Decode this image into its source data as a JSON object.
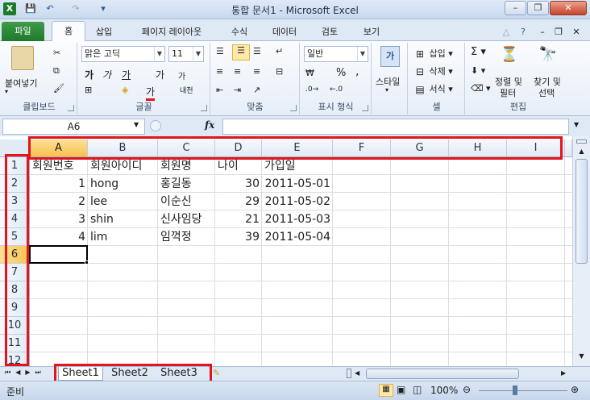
{
  "window": {
    "title": "통합 문서1  -  Microsoft Excel",
    "minimize": "–",
    "restore": "❐",
    "close": "✕"
  },
  "quick_access": {
    "save_icon": "save-icon",
    "undo_icon": "undo-icon",
    "redo_icon": "redo-icon"
  },
  "tabs": [
    {
      "label": "파일"
    },
    {
      "label": "홈"
    },
    {
      "label": "삽입"
    },
    {
      "label": "페이지 레이아웃"
    },
    {
      "label": "수식"
    },
    {
      "label": "데이터"
    },
    {
      "label": "검토"
    },
    {
      "label": "보기"
    }
  ],
  "ribbon": {
    "clipboard": {
      "label": "클립보드",
      "paste": "붙여넣기"
    },
    "font": {
      "label": "글꼴",
      "name": "맑은 고딕",
      "size": "11",
      "bold": "가",
      "italic": "가",
      "underline": "가",
      "grow": "가",
      "shrink": "가",
      "color": "가",
      "phonetic": "내천"
    },
    "alignment": {
      "label": "맞춤"
    },
    "number": {
      "label": "표시 형식",
      "format": "일반",
      "percent": "%",
      "comma": ","
    },
    "styles": {
      "label": "스타일"
    },
    "cells": {
      "label": "셀",
      "insert": "삽입",
      "delete": "삭제",
      "format": "서식"
    },
    "editing": {
      "label": "편집",
      "sort": "정렬 및",
      "sort2": "필터",
      "find": "찾기 및",
      "find2": "선택"
    }
  },
  "formula_bar": {
    "name_box": "A6",
    "fx": "fx",
    "value": ""
  },
  "columns": [
    "A",
    "B",
    "C",
    "D",
    "E",
    "F",
    "G",
    "H",
    "I"
  ],
  "rows": [
    "1",
    "2",
    "3",
    "4",
    "5",
    "6",
    "7",
    "8",
    "9",
    "10",
    "11",
    "12"
  ],
  "cells": {
    "r1": [
      "회원번호",
      "회원아이디",
      "회원명",
      "나이",
      "가입일"
    ],
    "r2": [
      "1",
      "hong",
      "홍길동",
      "30",
      "2011-05-01"
    ],
    "r3": [
      "2",
      "lee",
      "이순신",
      "29",
      "2011-05-02"
    ],
    "r4": [
      "3",
      "shin",
      "신사임당",
      "21",
      "2011-05-03"
    ],
    "r5": [
      "4",
      "lim",
      "임꺽정",
      "39",
      "2011-05-04"
    ]
  },
  "sheets": [
    "Sheet1",
    "Sheet2",
    "Sheet3"
  ],
  "status": {
    "mode": "준비",
    "zoom": "100%"
  },
  "colors": {
    "highlight": "#e3141c",
    "selected_header": "#f7c34f",
    "file_tab": "#1e7a2b"
  }
}
